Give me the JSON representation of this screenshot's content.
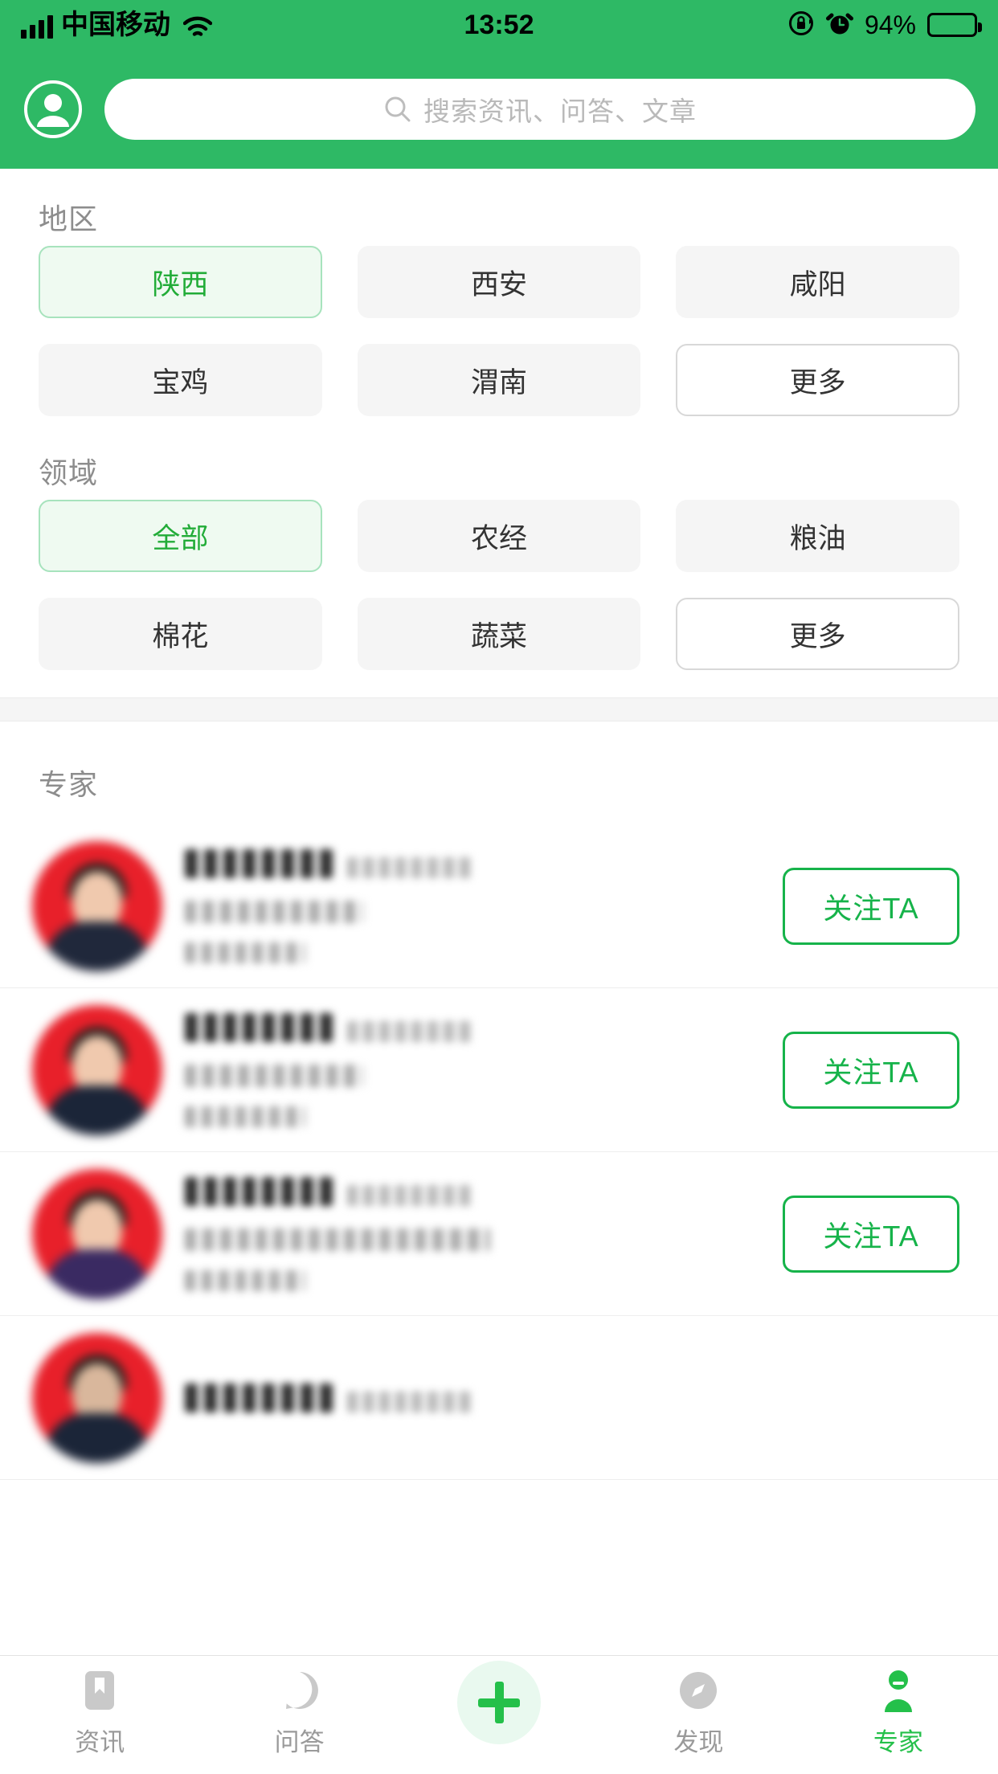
{
  "status_bar": {
    "carrier": "中国移动",
    "time": "13:52",
    "battery_percent": "94%",
    "icons": [
      "signal-icon",
      "wifi-icon",
      "rotation-lock-icon",
      "alarm-icon",
      "battery-icon"
    ]
  },
  "header": {
    "profile_icon": "user-avatar-icon",
    "search": {
      "icon": "search-icon",
      "placeholder": "搜索资讯、问答、文章",
      "value": ""
    }
  },
  "filters": [
    {
      "id": "region",
      "title": "地区",
      "chips": [
        {
          "label": "陕西",
          "state": "selected"
        },
        {
          "label": "西安",
          "state": "normal"
        },
        {
          "label": "咸阳",
          "state": "normal"
        },
        {
          "label": "宝鸡",
          "state": "normal"
        },
        {
          "label": "渭南",
          "state": "normal"
        },
        {
          "label": "更多",
          "state": "more"
        }
      ]
    },
    {
      "id": "field",
      "title": "领域",
      "chips": [
        {
          "label": "全部",
          "state": "selected"
        },
        {
          "label": "农经",
          "state": "normal"
        },
        {
          "label": "粮油",
          "state": "normal"
        },
        {
          "label": "棉花",
          "state": "normal"
        },
        {
          "label": "蔬菜",
          "state": "normal"
        },
        {
          "label": "更多",
          "state": "more"
        }
      ]
    }
  ],
  "experts": {
    "title": "专家",
    "follow_label": "关注TA",
    "rows": [
      {
        "name": "",
        "subtitle": "",
        "detail1": "",
        "detail2": "",
        "avatar": "expert-avatar-female",
        "follow_label": "关注TA"
      },
      {
        "name": "",
        "subtitle": "",
        "detail1": "",
        "detail2": "",
        "avatar": "expert-avatar-male",
        "follow_label": "关注TA"
      },
      {
        "name": "",
        "subtitle": "",
        "detail1": "",
        "detail2": "",
        "avatar": "expert-avatar-male-purple",
        "follow_label": "关注TA"
      },
      {
        "name": "",
        "subtitle": "",
        "detail1": "",
        "detail2": "",
        "avatar": "expert-avatar-partial",
        "follow_label": ""
      }
    ]
  },
  "tabbar": {
    "items": [
      {
        "label": "资讯",
        "icon": "bookmark-icon",
        "active": false
      },
      {
        "label": "问答",
        "icon": "question-mark-icon",
        "active": false
      },
      {
        "label": "",
        "icon": "plus-icon",
        "active": false
      },
      {
        "label": "发现",
        "icon": "compass-icon",
        "active": false
      },
      {
        "label": "专家",
        "icon": "person-icon",
        "active": true
      }
    ]
  },
  "colors": {
    "brand_green": "#2EB965",
    "accent_green": "#22ac38",
    "follow_green": "#16b34a",
    "chip_bg": "#f5f5f5",
    "chip_selected_bg": "#effaf1",
    "text_muted": "#8d8d8d"
  }
}
